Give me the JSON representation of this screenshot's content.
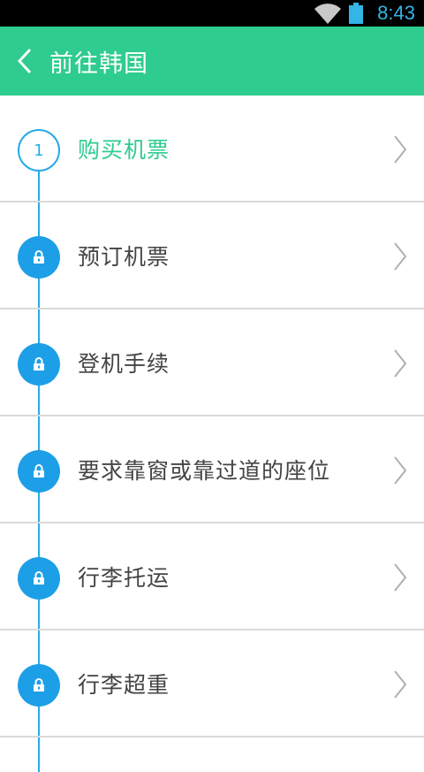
{
  "status_bar": {
    "time": "8:43"
  },
  "header": {
    "title": "前往韩国"
  },
  "steps": [
    {
      "label": "购买机票",
      "state": "current",
      "number": "1"
    },
    {
      "label": "预订机票",
      "state": "locked"
    },
    {
      "label": "登机手续",
      "state": "locked"
    },
    {
      "label": "要求靠窗或靠过道的座位",
      "state": "locked"
    },
    {
      "label": "行李托运",
      "state": "locked"
    },
    {
      "label": "行李超重",
      "state": "locked"
    }
  ],
  "colors": {
    "accent_green": "#2ecc8e",
    "timeline_blue": "#29a9e8",
    "status_time": "#33b5e5"
  }
}
